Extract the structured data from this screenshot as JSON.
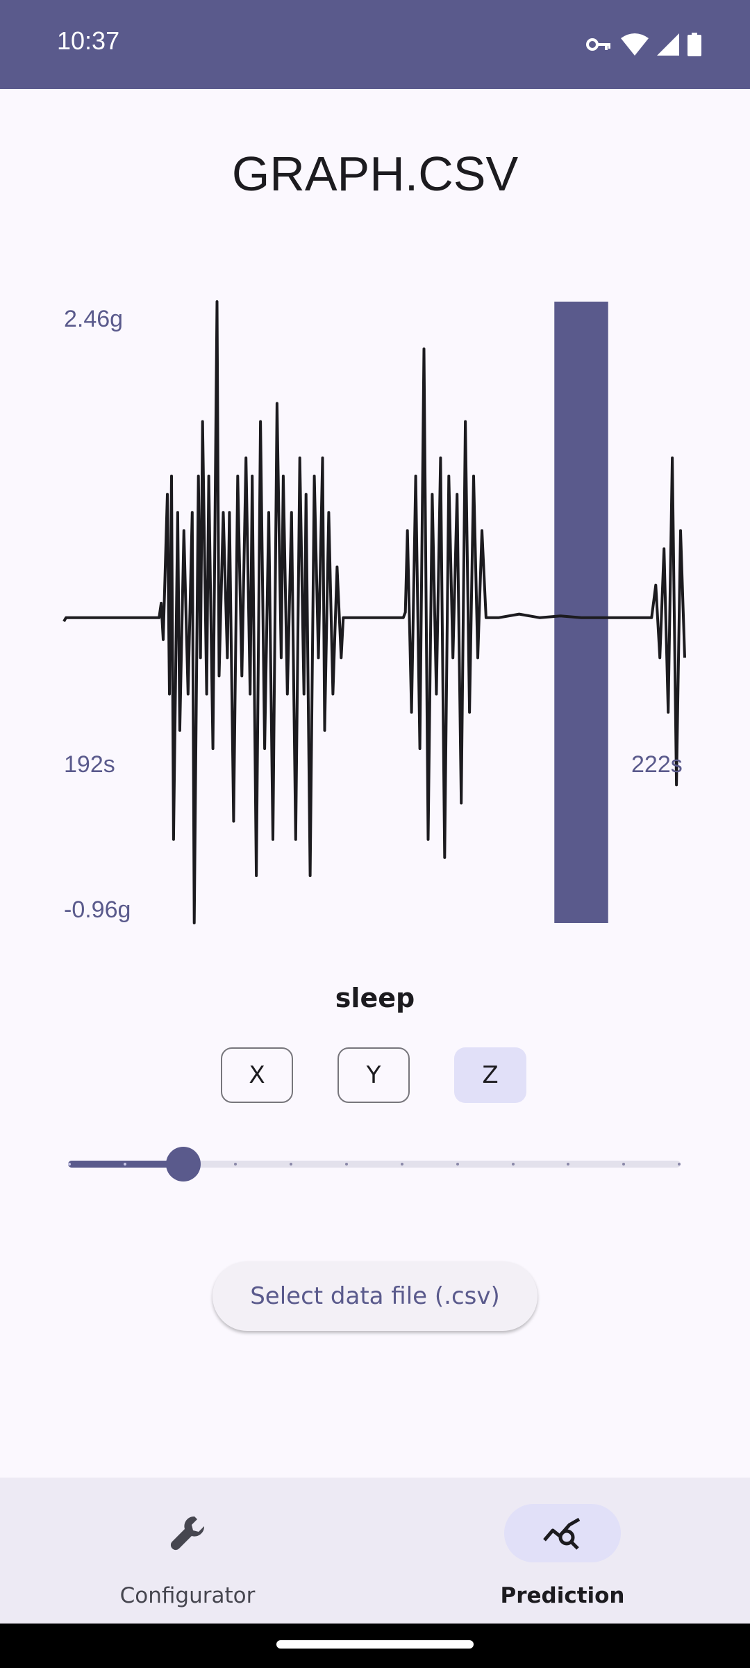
{
  "status_bar": {
    "time": "10:37",
    "icons": [
      "vpn-key-icon",
      "wifi-icon",
      "cell-signal-icon",
      "battery-icon"
    ]
  },
  "header": {
    "title": "GRAPH.CSV"
  },
  "chart_data": {
    "type": "line",
    "y_max_label": "2.46g",
    "y_min_label": "-0.96g",
    "x_start_label": "192s",
    "x_end_label": "222s",
    "ylim": [
      -0.96,
      2.46
    ],
    "xlim": [
      192,
      222
    ],
    "baseline": 0.72,
    "series": [
      {
        "values": [
          [
            192.0,
            0.7
          ],
          [
            192.1,
            0.72
          ],
          [
            194.5,
            0.72
          ],
          [
            196.6,
            0.72
          ],
          [
            196.7,
            0.8
          ],
          [
            196.8,
            0.6
          ],
          [
            197.0,
            1.4
          ],
          [
            197.1,
            0.3
          ],
          [
            197.2,
            1.5
          ],
          [
            197.3,
            -0.5
          ],
          [
            197.5,
            1.3
          ],
          [
            197.6,
            0.1
          ],
          [
            197.8,
            1.2
          ],
          [
            198.0,
            0.3
          ],
          [
            198.2,
            1.3
          ],
          [
            198.3,
            -0.96
          ],
          [
            198.5,
            1.5
          ],
          [
            198.6,
            0.5
          ],
          [
            198.7,
            1.8
          ],
          [
            198.9,
            0.3
          ],
          [
            199.0,
            1.5
          ],
          [
            199.2,
            0.0
          ],
          [
            199.4,
            2.46
          ],
          [
            199.5,
            0.4
          ],
          [
            199.7,
            1.3
          ],
          [
            199.9,
            0.5
          ],
          [
            200.0,
            1.3
          ],
          [
            200.2,
            -0.4
          ],
          [
            200.4,
            1.5
          ],
          [
            200.6,
            0.4
          ],
          [
            200.8,
            1.6
          ],
          [
            201.0,
            0.3
          ],
          [
            201.1,
            1.5
          ],
          [
            201.3,
            -0.7
          ],
          [
            201.5,
            1.8
          ],
          [
            201.7,
            0.0
          ],
          [
            201.9,
            1.3
          ],
          [
            202.1,
            -0.5
          ],
          [
            202.3,
            1.9
          ],
          [
            202.5,
            0.5
          ],
          [
            202.6,
            1.5
          ],
          [
            202.8,
            0.3
          ],
          [
            203.0,
            1.3
          ],
          [
            203.2,
            -0.5
          ],
          [
            203.4,
            1.6
          ],
          [
            203.6,
            0.3
          ],
          [
            203.7,
            1.4
          ],
          [
            203.9,
            -0.7
          ],
          [
            204.1,
            1.5
          ],
          [
            204.3,
            0.5
          ],
          [
            204.5,
            1.6
          ],
          [
            204.6,
            0.1
          ],
          [
            204.8,
            1.3
          ],
          [
            205.0,
            0.3
          ],
          [
            205.2,
            1.0
          ],
          [
            205.4,
            0.5
          ],
          [
            205.5,
            0.72
          ],
          [
            206.0,
            0.72
          ],
          [
            207.0,
            0.72
          ],
          [
            208.0,
            0.72
          ],
          [
            208.4,
            0.72
          ],
          [
            208.5,
            0.75
          ],
          [
            208.6,
            1.2
          ],
          [
            208.8,
            0.2
          ],
          [
            209.0,
            1.5
          ],
          [
            209.2,
            0.0
          ],
          [
            209.4,
            2.2
          ],
          [
            209.6,
            -0.5
          ],
          [
            209.8,
            1.4
          ],
          [
            210.0,
            0.3
          ],
          [
            210.2,
            1.6
          ],
          [
            210.4,
            -0.6
          ],
          [
            210.6,
            1.5
          ],
          [
            210.8,
            0.5
          ],
          [
            211.0,
            1.4
          ],
          [
            211.2,
            -0.3
          ],
          [
            211.4,
            1.8
          ],
          [
            211.6,
            0.2
          ],
          [
            211.8,
            1.5
          ],
          [
            212.0,
            0.5
          ],
          [
            212.2,
            1.2
          ],
          [
            212.4,
            0.72
          ],
          [
            213.0,
            0.72
          ],
          [
            214.0,
            0.74
          ],
          [
            215.0,
            0.72
          ],
          [
            216.0,
            0.73
          ],
          [
            217.0,
            0.72
          ],
          [
            218.0,
            0.72
          ],
          [
            219.0,
            0.72
          ],
          [
            220.0,
            0.72
          ],
          [
            220.4,
            0.72
          ],
          [
            220.6,
            0.9
          ],
          [
            220.8,
            0.5
          ],
          [
            221.0,
            1.1
          ],
          [
            221.2,
            0.2
          ],
          [
            221.4,
            1.6
          ],
          [
            221.6,
            -0.2
          ],
          [
            221.8,
            1.2
          ],
          [
            222.0,
            0.5
          ]
        ]
      }
    ],
    "highlight_window": [
      215.7,
      218.3
    ],
    "highlight_color": "#5a5a8c",
    "line_color": "#1c1b1f"
  },
  "prediction": {
    "label": "sleep"
  },
  "axis_toggles": [
    {
      "label": "X",
      "selected": false
    },
    {
      "label": "Y",
      "selected": false
    },
    {
      "label": "Z",
      "selected": true
    }
  ],
  "slider": {
    "value_index": 2,
    "steps": 12
  },
  "actions": {
    "select_file_label": "Select data file (.csv)"
  },
  "bottom_nav": {
    "items": [
      {
        "label": "Configurator",
        "icon": "wrench-icon",
        "active": false
      },
      {
        "label": "Prediction",
        "icon": "chart-search-icon",
        "active": true
      }
    ]
  },
  "colors": {
    "primary": "#5a5a8c",
    "surface": "#fbf8fe",
    "selected_container": "#e1e0f8",
    "nav_background": "#edeaf4"
  }
}
